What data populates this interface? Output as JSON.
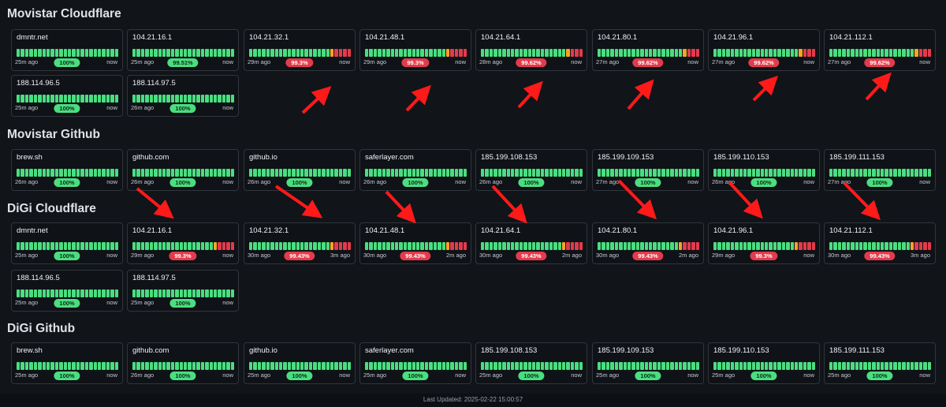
{
  "colors": {
    "up": "#4ade80",
    "warn": "#f5a524",
    "down": "#e33b4b"
  },
  "groups": [
    {
      "title": "Movistar Cloudflare",
      "cards": [
        {
          "name": "dmntr.net",
          "from": "25m ago",
          "to": "now",
          "uptime": "100%",
          "status": "ok",
          "bars": "GGGGGGGGGGGGGGGGGGGGGGGG"
        },
        {
          "name": "104.21.16.1",
          "from": "25m ago",
          "to": "now",
          "uptime": "99.51%",
          "status": "ok",
          "bars": "GGGGGGGGGGGGGGGGGGGGGGGG"
        },
        {
          "name": "104.21.32.1",
          "from": "29m ago",
          "to": "now",
          "uptime": "99.3%",
          "status": "bad",
          "bars": "GGGGGGGGGGGGGGGGGGGYRRRR"
        },
        {
          "name": "104.21.48.1",
          "from": "29m ago",
          "to": "now",
          "uptime": "99.3%",
          "status": "bad",
          "bars": "GGGGGGGGGGGGGGGGGGGYRRRR"
        },
        {
          "name": "104.21.64.1",
          "from": "28m ago",
          "to": "now",
          "uptime": "99.62%",
          "status": "bad",
          "bars": "GGGGGGGGGGGGGGGGGGGGYRRR"
        },
        {
          "name": "104.21.80.1",
          "from": "27m ago",
          "to": "now",
          "uptime": "99.62%",
          "status": "bad",
          "bars": "GGGGGGGGGGGGGGGGGGGGYRRR"
        },
        {
          "name": "104.21.96.1",
          "from": "27m ago",
          "to": "now",
          "uptime": "99.62%",
          "status": "bad",
          "bars": "GGGGGGGGGGGGGGGGGGGGYRRR"
        },
        {
          "name": "104.21.112.1",
          "from": "27m ago",
          "to": "now",
          "uptime": "99.62%",
          "status": "bad",
          "bars": "GGGGGGGGGGGGGGGGGGGGYRRR"
        },
        {
          "name": "188.114.96.5",
          "from": "25m ago",
          "to": "now",
          "uptime": "100%",
          "status": "ok",
          "bars": "GGGGGGGGGGGGGGGGGGGGGGGG"
        },
        {
          "name": "188.114.97.5",
          "from": "26m ago",
          "to": "now",
          "uptime": "100%",
          "status": "ok",
          "bars": "GGGGGGGGGGGGGGGGGGGGGGGG"
        }
      ]
    },
    {
      "title": "Movistar Github",
      "cards": [
        {
          "name": "brew.sh",
          "from": "26m ago",
          "to": "now",
          "uptime": "100%",
          "status": "ok",
          "bars": "GGGGGGGGGGGGGGGGGGGGGGGG"
        },
        {
          "name": "github.com",
          "from": "26m ago",
          "to": "now",
          "uptime": "100%",
          "status": "ok",
          "bars": "GGGGGGGGGGGGGGGGGGGGGGGG"
        },
        {
          "name": "github.io",
          "from": "26m ago",
          "to": "now",
          "uptime": "100%",
          "status": "ok",
          "bars": "GGGGGGGGGGGGGGGGGGGGGGGG"
        },
        {
          "name": "saferlayer.com",
          "from": "26m ago",
          "to": "now",
          "uptime": "100%",
          "status": "ok",
          "bars": "GGGGGGGGGGGGGGGGGGGGGGGG"
        },
        {
          "name": "185.199.108.153",
          "from": "26m ago",
          "to": "now",
          "uptime": "100%",
          "status": "ok",
          "bars": "GGGGGGGGGGGGGGGGGGGGGGGG"
        },
        {
          "name": "185.199.109.153",
          "from": "27m ago",
          "to": "now",
          "uptime": "100%",
          "status": "ok",
          "bars": "GGGGGGGGGGGGGGGGGGGGGGGG"
        },
        {
          "name": "185.199.110.153",
          "from": "26m ago",
          "to": "now",
          "uptime": "100%",
          "status": "ok",
          "bars": "GGGGGGGGGGGGGGGGGGGGGGGG"
        },
        {
          "name": "185.199.111.153",
          "from": "27m ago",
          "to": "now",
          "uptime": "100%",
          "status": "ok",
          "bars": "GGGGGGGGGGGGGGGGGGGGGGGG"
        }
      ]
    },
    {
      "title": "DiGi Cloudflare",
      "cards": [
        {
          "name": "dmntr.net",
          "from": "25m ago",
          "to": "now",
          "uptime": "100%",
          "status": "ok",
          "bars": "GGGGGGGGGGGGGGGGGGGGGGGG"
        },
        {
          "name": "104.21.16.1",
          "from": "29m ago",
          "to": "now",
          "uptime": "99.3%",
          "status": "bad",
          "bars": "GGGGGGGGGGGGGGGGGGGYRRRR"
        },
        {
          "name": "104.21.32.1",
          "from": "30m ago",
          "to": "3m ago",
          "uptime": "99.43%",
          "status": "bad",
          "bars": "GGGGGGGGGGGGGGGGGGGYRRRR"
        },
        {
          "name": "104.21.48.1",
          "from": "30m ago",
          "to": "2m ago",
          "uptime": "99.43%",
          "status": "bad",
          "bars": "GGGGGGGGGGGGGGGGGGGYRRRR"
        },
        {
          "name": "104.21.64.1",
          "from": "30m ago",
          "to": "2m ago",
          "uptime": "99.43%",
          "status": "bad",
          "bars": "GGGGGGGGGGGGGGGGGGGYRRRR"
        },
        {
          "name": "104.21.80.1",
          "from": "30m ago",
          "to": "2m ago",
          "uptime": "99.43%",
          "status": "bad",
          "bars": "GGGGGGGGGGGGGGGGGGGYRRRR"
        },
        {
          "name": "104.21.96.1",
          "from": "29m ago",
          "to": "now",
          "uptime": "99.3%",
          "status": "bad",
          "bars": "GGGGGGGGGGGGGGGGGGGYRRRR"
        },
        {
          "name": "104.21.112.1",
          "from": "30m ago",
          "to": "3m ago",
          "uptime": "99.43%",
          "status": "bad",
          "bars": "GGGGGGGGGGGGGGGGGGGYRRRR"
        },
        {
          "name": "188.114.96.5",
          "from": "25m ago",
          "to": "now",
          "uptime": "100%",
          "status": "ok",
          "bars": "GGGGGGGGGGGGGGGGGGGGGGGG"
        },
        {
          "name": "188.114.97.5",
          "from": "25m ago",
          "to": "now",
          "uptime": "100%",
          "status": "ok",
          "bars": "GGGGGGGGGGGGGGGGGGGGGGGG"
        }
      ]
    },
    {
      "title": "DiGi Github",
      "cards": [
        {
          "name": "brew.sh",
          "from": "25m ago",
          "to": "now",
          "uptime": "100%",
          "status": "ok",
          "bars": "GGGGGGGGGGGGGGGGGGGGGGGG"
        },
        {
          "name": "github.com",
          "from": "26m ago",
          "to": "now",
          "uptime": "100%",
          "status": "ok",
          "bars": "GGGGGGGGGGGGGGGGGGGGGGGG"
        },
        {
          "name": "github.io",
          "from": "25m ago",
          "to": "now",
          "uptime": "100%",
          "status": "ok",
          "bars": "GGGGGGGGGGGGGGGGGGGGGGGG"
        },
        {
          "name": "saferlayer.com",
          "from": "25m ago",
          "to": "now",
          "uptime": "100%",
          "status": "ok",
          "bars": "GGGGGGGGGGGGGGGGGGGGGGGG"
        },
        {
          "name": "185.199.108.153",
          "from": "25m ago",
          "to": "now",
          "uptime": "100%",
          "status": "ok",
          "bars": "GGGGGGGGGGGGGGGGGGGGGGGG"
        },
        {
          "name": "185.199.109.153",
          "from": "25m ago",
          "to": "now",
          "uptime": "100%",
          "status": "ok",
          "bars": "GGGGGGGGGGGGGGGGGGGGGGGG"
        },
        {
          "name": "185.199.110.153",
          "from": "25m ago",
          "to": "now",
          "uptime": "100%",
          "status": "ok",
          "bars": "GGGGGGGGGGGGGGGGGGGGGGGG"
        },
        {
          "name": "185.199.111.153",
          "from": "25m ago",
          "to": "now",
          "uptime": "100%",
          "status": "ok",
          "bars": "GGGGGGGGGGGGGGGGGGGGGGGG"
        }
      ]
    }
  ],
  "footer": "Last Updated: 2025-02-22 15:00:57"
}
